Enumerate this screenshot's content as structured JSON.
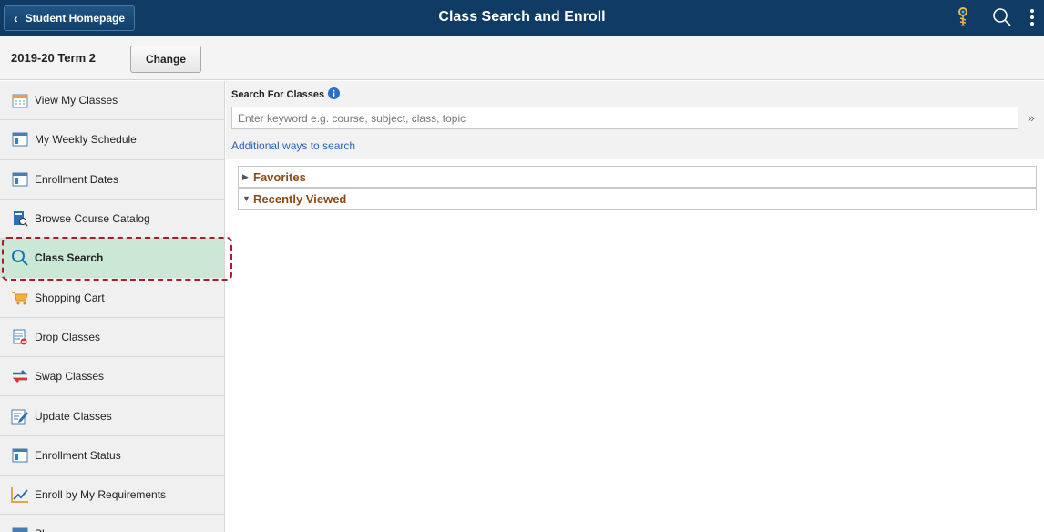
{
  "header": {
    "back_label": "Student Homepage",
    "title": "Class Search and Enroll",
    "icons": [
      "navbar-icon",
      "search-icon",
      "actions-menu-icon"
    ]
  },
  "term": {
    "label": "2019-20 Term 2",
    "change_label": "Change"
  },
  "sidebar": {
    "items": [
      {
        "label": "View My Classes",
        "icon": "calendar-icon"
      },
      {
        "label": "My Weekly Schedule",
        "icon": "schedule-icon"
      },
      {
        "label": "Enrollment Dates",
        "icon": "schedule-icon"
      },
      {
        "label": "Browse Course Catalog",
        "icon": "catalog-icon"
      },
      {
        "label": "Class Search",
        "icon": "search-icon",
        "active": true
      },
      {
        "label": "Shopping Cart",
        "icon": "cart-icon"
      },
      {
        "label": "Drop Classes",
        "icon": "drop-icon"
      },
      {
        "label": "Swap Classes",
        "icon": "swap-icon"
      },
      {
        "label": "Update Classes",
        "icon": "edit-icon"
      },
      {
        "label": "Enrollment Status",
        "icon": "schedule-icon"
      },
      {
        "label": "Enroll by My Requirements",
        "icon": "chart-icon"
      },
      {
        "label": "Pl",
        "icon": "planner-icon"
      }
    ]
  },
  "search": {
    "title": "Search For Classes",
    "placeholder": "Enter keyword e.g. course, subject, class, topic",
    "value": "",
    "additional_link": "Additional ways to search"
  },
  "sections": [
    {
      "label": "Favorites",
      "expanded": false
    },
    {
      "label": "Recently Viewed",
      "expanded": true
    }
  ],
  "colors": {
    "header_bg": "#0f3b64",
    "active_bg": "#cbe8d6",
    "highlight": "#a3202a",
    "link": "#2d64b3",
    "accordion_label": "#8a4b14"
  }
}
